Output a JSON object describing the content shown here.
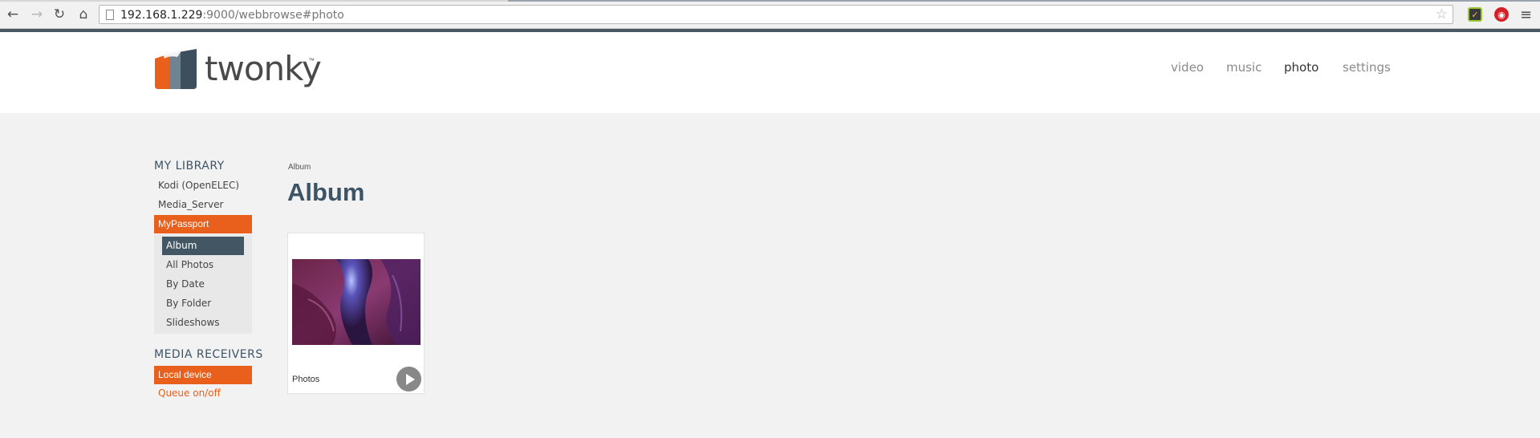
{
  "browser": {
    "url_host": "192.168.1.229",
    "url_rest": ":9000/webbrowse#photo"
  },
  "colors": {
    "accent_orange": "#e8601c",
    "header_slate": "#3d5466",
    "active_subitem": "#435663"
  },
  "logo": {
    "text": "twonky",
    "tm": "™"
  },
  "top_nav": {
    "items": [
      {
        "label": "video",
        "active": false
      },
      {
        "label": "music",
        "active": false
      },
      {
        "label": "photo",
        "active": true
      },
      {
        "label": "settings",
        "active": false
      }
    ]
  },
  "sidebar": {
    "library_heading": "MY LIBRARY",
    "library_items": [
      {
        "label": "Kodi (OpenELEC)"
      },
      {
        "label": "Media_Server"
      },
      {
        "label": "MyPassport",
        "selected": true
      }
    ],
    "sub_items": [
      {
        "label": "Album",
        "active": true
      },
      {
        "label": "All Photos"
      },
      {
        "label": "By Date"
      },
      {
        "label": "By Folder"
      },
      {
        "label": "Slideshows"
      }
    ],
    "receivers_heading": "MEDIA RECEIVERS",
    "receiver_item": "Local device",
    "queue_link": "Queue on/off"
  },
  "content": {
    "breadcrumb": "Album",
    "title": "Album",
    "albums": [
      {
        "name": "Photos",
        "thumbnail": "canyon-photo",
        "action_icon": "play-icon"
      }
    ]
  }
}
